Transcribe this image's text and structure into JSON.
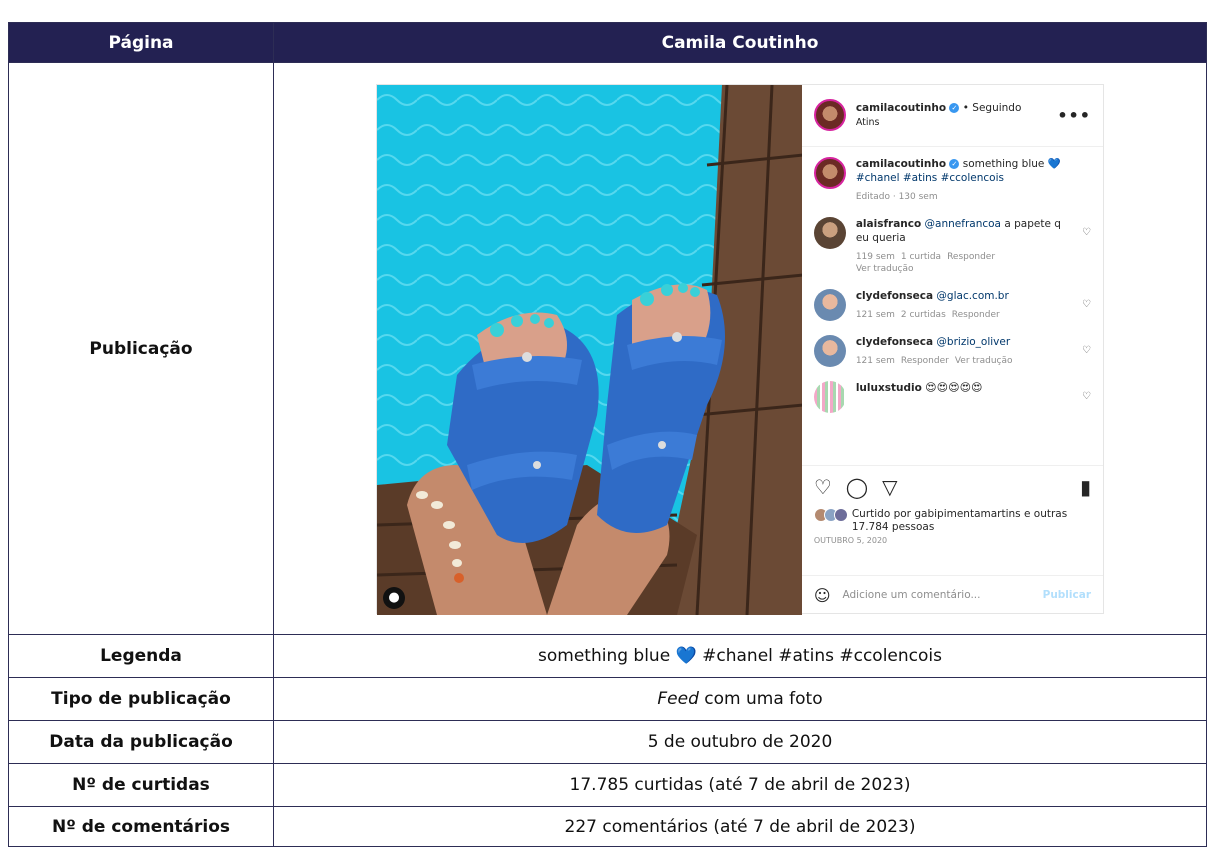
{
  "table": {
    "header": {
      "col1": "Página",
      "col2": "Camila Coutinho"
    },
    "rows": [
      {
        "label": "Publicação"
      },
      {
        "label": "Legenda",
        "value": "something blue 💙 #chanel #atins #ccolencois"
      },
      {
        "label": "Tipo de publicação",
        "value_em": "Feed",
        "value_rest": " com uma foto"
      },
      {
        "label": "Data da publicação",
        "value": "5 de outubro de 2020"
      },
      {
        "label": "Nº de curtidas",
        "value": "17.785 curtidas (até 7 de abril de 2023)"
      },
      {
        "label": "Nº de comentários",
        "value": "227 comentários (até 7 de abril de 2023)"
      }
    ]
  },
  "post": {
    "header": {
      "username": "camilacoutinho",
      "following": "• Seguindo",
      "location": "Atins",
      "more": "•••"
    },
    "caption": {
      "username": "camilacoutinho",
      "text": "something blue",
      "emoji": "💙",
      "hashtags": "#chanel #atins #ccolencois",
      "meta": "Editado · 130 sem"
    },
    "comments": [
      {
        "username": "alaisfranco",
        "mention": "@annefrancoa",
        "text": " a papete q eu queria",
        "time": "119 sem",
        "likes": "1 curtida",
        "reply": "Responder",
        "translate": "Ver tradução"
      },
      {
        "username": "clydefonseca",
        "mention": "@glac.com.br",
        "text": "",
        "time": "121 sem",
        "likes": "2 curtidas",
        "reply": "Responder"
      },
      {
        "username": "clydefonseca",
        "mention": "@brizio_oliver",
        "text": "",
        "time": "121 sem",
        "reply": "Responder",
        "translate": "Ver tradução"
      },
      {
        "username": "luluxstudio",
        "text": "😍😍😍😍😍"
      }
    ],
    "liked_by_prefix": "Curtido por ",
    "liked_by_user": "gabipimentamartins",
    "liked_by_suffix": " e outras 17.784 pessoas",
    "date": "OUTUBRO 5, 2020",
    "add_comment_placeholder": "Adicione um comentário...",
    "publish_label": "Publicar"
  }
}
